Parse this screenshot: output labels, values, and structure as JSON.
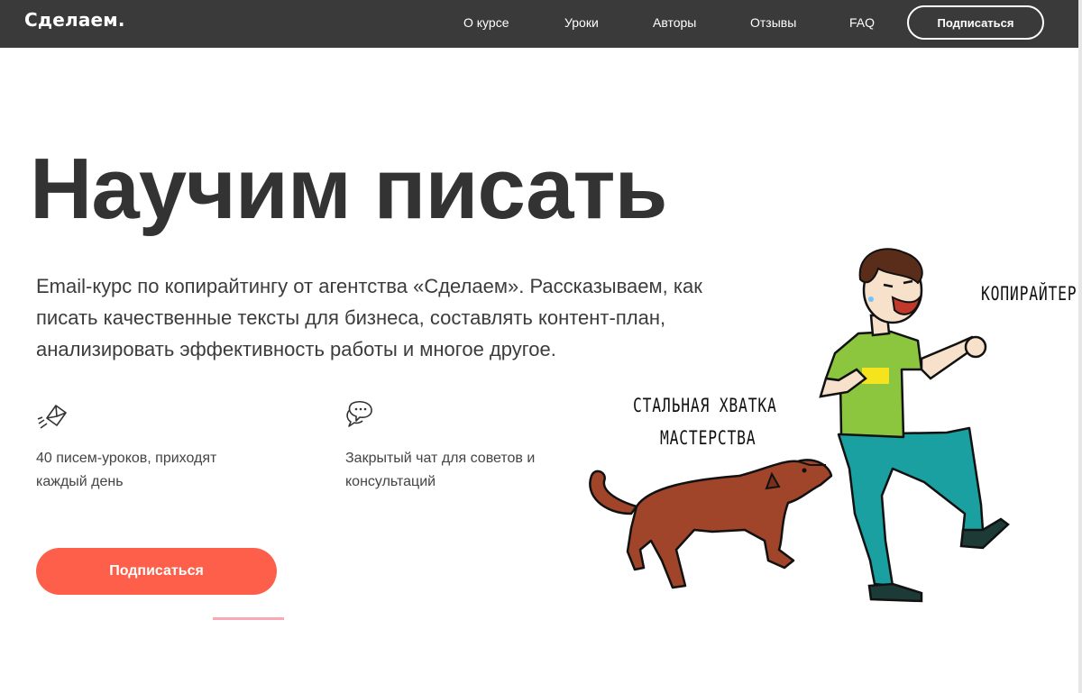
{
  "header": {
    "logo": "Сделаем.",
    "nav": [
      "О курсе",
      "Уроки",
      "Авторы",
      "Отзывы",
      "FAQ"
    ],
    "cta_label": "Подписаться"
  },
  "hero": {
    "title": "Научим писать",
    "description": "Email-курс по копирайтингу от агентства «Сделаем». Рассказываем, как писать качественные тексты для бизнеса, составлять контент-план, анализировать эффективность работы и многое другое."
  },
  "features": [
    {
      "icon": "envelope-send-icon",
      "text": "40 писем-уроков, приходят каждый день"
    },
    {
      "icon": "chat-bubbles-icon",
      "text": "Закрытый чат для советов и консультаций"
    }
  ],
  "cta": {
    "label": "Подписаться",
    "color": "#fe5f4b"
  },
  "illustration": {
    "label_person": "КОПИРАЙТЕР",
    "label_dog_line1": "СТАЛЬНАЯ ХВАТКА",
    "label_dog_line2": "МАСТЕРСТВА"
  },
  "colors": {
    "header_bg": "#3a3a3a",
    "accent": "#fe5f4b",
    "shirt": "#8cc63f",
    "pants": "#1a9e9e",
    "dog": "#a0442a"
  }
}
